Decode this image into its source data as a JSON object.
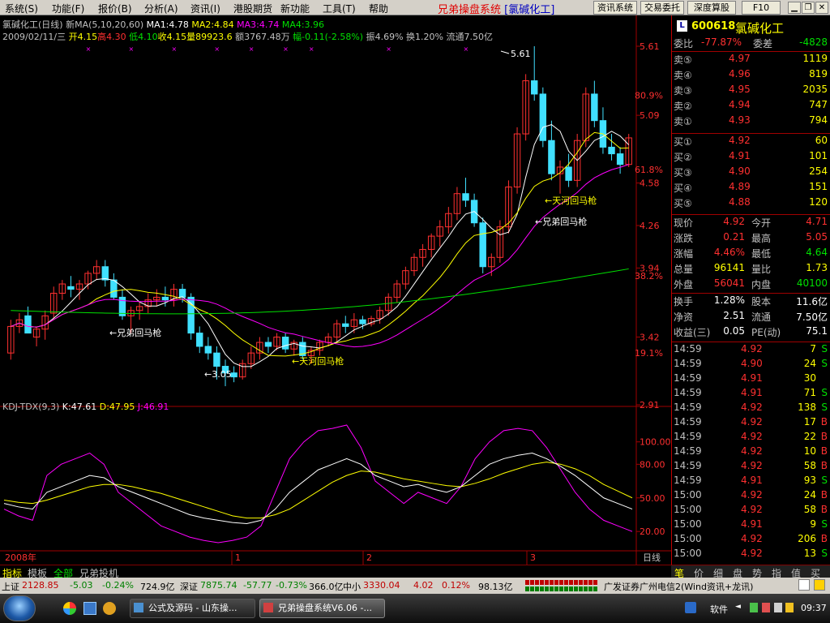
{
  "menu": {
    "items": [
      "系统(S)",
      "功能(F)",
      "报价(B)",
      "分析(A)",
      "资讯(I)",
      "港股期货",
      "新功能",
      "工具(T)",
      "帮助"
    ],
    "app_title": "兄弟操盘系统",
    "stock_tag": "[氯碱化工]",
    "tools": [
      "资讯系统",
      "交易委托",
      "深度算股"
    ],
    "f10": "F10"
  },
  "chart": {
    "line1": {
      "name": "氯碱化工(日线)",
      "ma_label": "新MA(5,10,20,60)",
      "ma1": "MA1:4.78",
      "ma2": "MA2:4.84",
      "ma3": "MA3:4.74",
      "ma4": "MA4:3.96"
    },
    "line2": {
      "date": "2009/02/11/三",
      "open": "开4.15",
      "high": "高4.30",
      "low": "低4.10",
      "close": "收4.15",
      "vol": "量89923.6",
      "amt": "额3767.48万",
      "chg": "幅-0.11(-2.58%)",
      "amp": "振4.69%",
      "turn": "换1.20%",
      "float": "流通7.50亿"
    },
    "price_labels": [
      "5.61",
      "5.09",
      "4.58",
      "4.26",
      "3.94",
      "3.42",
      "2.91"
    ],
    "pct_labels": [
      "80.9%",
      "61.8%",
      "38.2%",
      "19.1%"
    ],
    "annotations": [
      "←兄弟回马枪",
      "←天河回马枪",
      "←兄弟回马枪",
      "←天河回马枪"
    ],
    "high_label": "5.61",
    "low_label": "←3.05",
    "kdj": {
      "name": "KDJ-TDX(9,3)",
      "k": "K:47.61",
      "d": "D:47.95",
      "j": "J:46.91"
    },
    "kdj_labels": [
      "100.00",
      "80.00",
      "50.00",
      "20.00"
    ],
    "time_labels": [
      "2008年",
      "1",
      "2",
      "3"
    ],
    "period": "日线",
    "colors": {
      "up": "#ff3030",
      "down": "#40e0ff",
      "ma1": "#ffffff",
      "ma2": "#ffff00",
      "ma3": "#ff00ff",
      "ma4": "#00e000"
    }
  },
  "chart_data": {
    "type": "candlestick",
    "title": "氯碱化工(日线)",
    "ylim": [
      2.91,
      5.61
    ],
    "candles": [
      [
        3.3,
        3.55,
        3.25,
        3.5
      ],
      [
        3.5,
        3.6,
        3.45,
        3.55
      ],
      [
        3.58,
        3.65,
        3.5,
        3.45
      ],
      [
        3.42,
        3.5,
        3.35,
        3.48
      ],
      [
        3.48,
        3.62,
        3.4,
        3.58
      ],
      [
        3.6,
        3.8,
        3.55,
        3.75
      ],
      [
        3.75,
        3.85,
        3.7,
        3.82
      ],
      [
        3.8,
        3.88,
        3.72,
        3.78
      ],
      [
        3.78,
        3.85,
        3.7,
        3.82
      ],
      [
        3.82,
        3.92,
        3.78,
        3.9
      ],
      [
        3.9,
        4.0,
        3.85,
        3.95
      ],
      [
        3.95,
        4.0,
        3.8,
        3.85
      ],
      [
        3.85,
        3.9,
        3.7,
        3.72
      ],
      [
        3.72,
        3.78,
        3.55,
        3.58
      ],
      [
        3.58,
        3.65,
        3.45,
        3.62
      ],
      [
        3.62,
        3.68,
        3.55,
        3.65
      ],
      [
        3.65,
        3.75,
        3.6,
        3.7
      ],
      [
        3.7,
        3.78,
        3.65,
        3.72
      ],
      [
        3.72,
        3.8,
        3.65,
        3.7
      ],
      [
        3.7,
        3.82,
        3.65,
        3.78
      ],
      [
        3.78,
        3.82,
        3.68,
        3.72
      ],
      [
        3.72,
        3.75,
        3.4,
        3.45
      ],
      [
        3.45,
        3.5,
        3.3,
        3.35
      ],
      [
        3.35,
        3.42,
        3.25,
        3.3
      ],
      [
        3.3,
        3.35,
        3.1,
        3.2
      ],
      [
        3.2,
        3.25,
        3.05,
        3.15
      ],
      [
        3.15,
        3.2,
        3.08,
        3.12
      ],
      [
        3.12,
        3.25,
        3.1,
        3.22
      ],
      [
        3.22,
        3.35,
        3.18,
        3.3
      ],
      [
        3.3,
        3.42,
        3.25,
        3.38
      ],
      [
        3.38,
        3.42,
        3.3,
        3.35
      ],
      [
        3.35,
        3.45,
        3.32,
        3.42
      ],
      [
        3.42,
        3.45,
        3.3,
        3.33
      ],
      [
        3.33,
        3.4,
        3.28,
        3.38
      ],
      [
        3.38,
        3.42,
        3.25,
        3.28
      ],
      [
        3.28,
        3.35,
        3.22,
        3.32
      ],
      [
        3.32,
        3.4,
        3.28,
        3.38
      ],
      [
        3.38,
        3.45,
        3.35,
        3.42
      ],
      [
        3.42,
        3.55,
        3.38,
        3.52
      ],
      [
        3.52,
        3.58,
        3.45,
        3.5
      ],
      [
        3.5,
        3.6,
        3.45,
        3.55
      ],
      [
        3.55,
        3.58,
        3.48,
        3.52
      ],
      [
        3.52,
        3.58,
        3.5,
        3.56
      ],
      [
        3.56,
        3.65,
        3.52,
        3.62
      ],
      [
        3.62,
        3.75,
        3.58,
        3.72
      ],
      [
        3.72,
        3.85,
        3.68,
        3.82
      ],
      [
        3.82,
        3.95,
        3.78,
        3.92
      ],
      [
        3.92,
        4.05,
        3.88,
        4.02
      ],
      [
        4.02,
        4.12,
        3.95,
        4.08
      ],
      [
        4.08,
        4.2,
        4.02,
        4.18
      ],
      [
        4.18,
        4.3,
        4.1,
        4.25
      ],
      [
        4.25,
        4.4,
        4.2,
        4.35
      ],
      [
        4.35,
        4.55,
        4.3,
        4.5
      ],
      [
        4.5,
        4.62,
        4.4,
        4.45
      ],
      [
        4.45,
        4.5,
        4.25,
        4.28
      ],
      [
        4.28,
        4.32,
        3.9,
        3.95
      ],
      [
        3.95,
        4.05,
        3.88,
        4.02
      ],
      [
        4.02,
        4.3,
        3.98,
        4.25
      ],
      [
        4.25,
        4.6,
        4.2,
        4.55
      ],
      [
        4.55,
        5.0,
        4.5,
        4.95
      ],
      [
        4.95,
        5.4,
        4.9,
        5.35
      ],
      [
        5.35,
        5.61,
        5.2,
        5.25
      ],
      [
        5.25,
        5.3,
        4.85,
        4.9
      ],
      [
        4.9,
        5.05,
        4.6,
        4.65
      ],
      [
        4.65,
        4.75,
        4.5,
        4.7
      ],
      [
        4.7,
        4.8,
        4.55,
        4.6
      ],
      [
        4.6,
        4.95,
        4.55,
        4.9
      ],
      [
        4.9,
        5.3,
        4.85,
        5.25
      ],
      [
        5.25,
        5.35,
        5.0,
        5.05
      ],
      [
        5.05,
        5.15,
        4.8,
        4.85
      ],
      [
        4.85,
        4.95,
        4.75,
        4.8
      ],
      [
        4.8,
        4.85,
        4.65,
        4.72
      ],
      [
        4.72,
        4.95,
        4.7,
        4.92
      ]
    ],
    "kdj": {
      "k": [
        45,
        42,
        40,
        55,
        60,
        65,
        70,
        68,
        60,
        55,
        50,
        45,
        40,
        35,
        32,
        30,
        28,
        27,
        30,
        40,
        55,
        65,
        75,
        80,
        85,
        80,
        70,
        65,
        60,
        62,
        58,
        55,
        60,
        70,
        80,
        85,
        88,
        90,
        85,
        78,
        70,
        60,
        50,
        45,
        40
      ],
      "d": [
        48,
        46,
        45,
        48,
        52,
        56,
        60,
        62,
        62,
        60,
        57,
        54,
        50,
        46,
        42,
        38,
        34,
        32,
        32,
        35,
        40,
        48,
        56,
        64,
        70,
        74,
        73,
        70,
        67,
        65,
        63,
        61,
        60,
        63,
        67,
        72,
        76,
        80,
        82,
        80,
        76,
        70,
        62,
        56,
        50
      ],
      "j": [
        40,
        34,
        30,
        70,
        80,
        85,
        90,
        80,
        55,
        45,
        35,
        25,
        20,
        15,
        12,
        10,
        12,
        15,
        25,
        55,
        85,
        100,
        110,
        112,
        115,
        95,
        65,
        55,
        45,
        55,
        50,
        45,
        60,
        85,
        100,
        110,
        112,
        110,
        95,
        75,
        55,
        40,
        30,
        25,
        20
      ]
    }
  },
  "right": {
    "code": "600618",
    "name": "氯碱化工",
    "weibi_label": "委比",
    "weibi_val": "-77.87%",
    "weicha_label": "委差",
    "weicha_val": "-4828",
    "sell": [
      {
        "label": "卖⑤",
        "price": "4.97",
        "vol": "1119"
      },
      {
        "label": "卖④",
        "price": "4.96",
        "vol": "819"
      },
      {
        "label": "卖③",
        "price": "4.95",
        "vol": "2035"
      },
      {
        "label": "卖②",
        "price": "4.94",
        "vol": "747"
      },
      {
        "label": "卖①",
        "price": "4.93",
        "vol": "794"
      }
    ],
    "buy": [
      {
        "label": "买①",
        "price": "4.92",
        "vol": "60"
      },
      {
        "label": "买②",
        "price": "4.91",
        "vol": "101"
      },
      {
        "label": "买③",
        "price": "4.90",
        "vol": "254"
      },
      {
        "label": "买④",
        "price": "4.89",
        "vol": "151"
      },
      {
        "label": "买⑤",
        "price": "4.88",
        "vol": "120"
      }
    ],
    "stats": [
      {
        "l1": "现价",
        "v1": "4.92",
        "l2": "今开",
        "v2": "4.71",
        "c1": "r",
        "c2": "r"
      },
      {
        "l1": "涨跌",
        "v1": "0.21",
        "l2": "最高",
        "v2": "5.05",
        "c1": "r",
        "c2": "r"
      },
      {
        "l1": "涨幅",
        "v1": "4.46%",
        "l2": "最低",
        "v2": "4.64",
        "c1": "r",
        "c2": "g"
      },
      {
        "l1": "总量",
        "v1": "96141",
        "l2": "量比",
        "v2": "1.73",
        "c1": "y",
        "c2": "y"
      },
      {
        "l1": "外盘",
        "v1": "56041",
        "l2": "内盘",
        "v2": "40100",
        "c1": "r",
        "c2": "g"
      }
    ],
    "stats2": [
      {
        "l1": "换手",
        "v1": "1.28%",
        "l2": "股本",
        "v2": "11.6亿"
      },
      {
        "l1": "净资",
        "v1": "2.51",
        "l2": "流通",
        "v2": "7.50亿"
      },
      {
        "l1": "收益(三)",
        "v1": "0.05",
        "l2": "PE(动)",
        "v2": "75.1"
      }
    ],
    "ticks": [
      {
        "t": "14:59",
        "p": "4.92",
        "v": "7",
        "s": "S"
      },
      {
        "t": "14:59",
        "p": "4.90",
        "v": "24",
        "s": "S"
      },
      {
        "t": "14:59",
        "p": "4.91",
        "v": "30",
        "s": ""
      },
      {
        "t": "14:59",
        "p": "4.91",
        "v": "71",
        "s": "S"
      },
      {
        "t": "14:59",
        "p": "4.92",
        "v": "138",
        "s": "S"
      },
      {
        "t": "14:59",
        "p": "4.92",
        "v": "17",
        "s": "B"
      },
      {
        "t": "14:59",
        "p": "4.92",
        "v": "22",
        "s": "B"
      },
      {
        "t": "14:59",
        "p": "4.92",
        "v": "10",
        "s": "B"
      },
      {
        "t": "14:59",
        "p": "4.92",
        "v": "58",
        "s": "B"
      },
      {
        "t": "14:59",
        "p": "4.91",
        "v": "93",
        "s": "S"
      },
      {
        "t": "15:00",
        "p": "4.92",
        "v": "24",
        "s": "B"
      },
      {
        "t": "15:00",
        "p": "4.92",
        "v": "58",
        "s": "B"
      },
      {
        "t": "15:00",
        "p": "4.91",
        "v": "9",
        "s": "S"
      },
      {
        "t": "15:00",
        "p": "4.92",
        "v": "206",
        "s": "B"
      },
      {
        "t": "15:00",
        "p": "4.92",
        "v": "13",
        "s": "S"
      }
    ],
    "bottom_tabs": [
      "笔",
      "价",
      "细",
      "盘",
      "势",
      "指",
      "值",
      "买"
    ]
  },
  "tabs": [
    "指标",
    "模板",
    "全部",
    "兄弟投机"
  ],
  "status": {
    "sh_label": "上证",
    "sh": "2128.85",
    "sh_chg": "-5.03",
    "sh_pct": "-0.24%",
    "sh_amt": "724.9亿",
    "sz_label": "深证",
    "sz": "7875.74",
    "sz_chg": "-57.77",
    "sz_pct": "-0.73%",
    "sz_amt": "366.0亿",
    "zx_label": "中小",
    "zx": "3330.04",
    "zx_chg": "4.02",
    "zx_pct": "0.12%",
    "zx_amt": "98.13亿",
    "broker": "广发证券广州电信2(Wind资讯+龙讯)"
  },
  "taskbar": {
    "tasks": [
      "公式及源码 - 山东操...",
      "兄弟操盘系统V6.06 -..."
    ],
    "tray_label": "软件",
    "clock": "09:37"
  }
}
